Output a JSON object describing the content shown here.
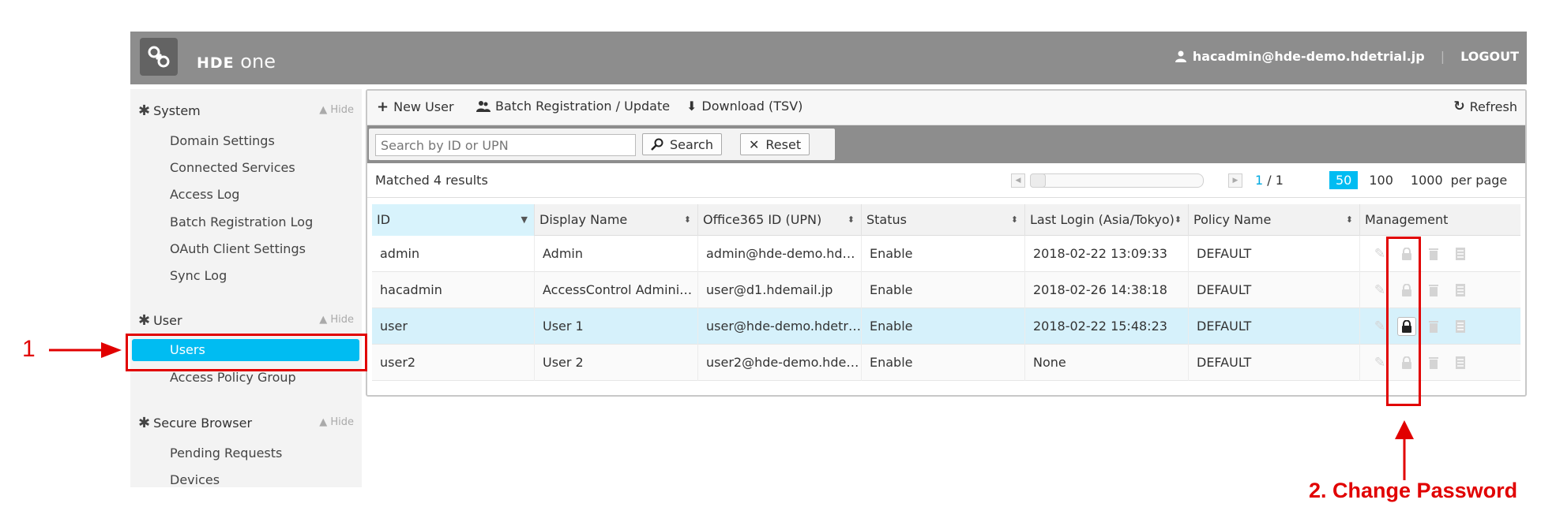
{
  "header": {
    "logo_brand": "HDE",
    "logo_product": "one",
    "user_email": "hacadmin@hde-demo.hdetrial.jp",
    "logout_label": "LOGOUT"
  },
  "sidebar": {
    "sections": [
      {
        "title": "System",
        "hide_label": "▲ Hide",
        "items": [
          "Domain Settings",
          "Connected Services",
          "Access Log",
          "Batch Registration Log",
          "OAuth Client Settings",
          "Sync Log"
        ]
      },
      {
        "title": "User",
        "hide_label": "▲ Hide",
        "items": [
          "Users",
          "Access Policy Group"
        ]
      },
      {
        "title": "Secure Browser",
        "hide_label": "▲ Hide",
        "items": [
          "Pending Requests",
          "Devices"
        ]
      }
    ],
    "active_item": "Users"
  },
  "toolbar": {
    "new_user": "New User",
    "batch": "Batch Registration / Update",
    "download": "Download (TSV)",
    "refresh": "Refresh"
  },
  "search": {
    "placeholder": "Search by ID or UPN",
    "search_label": "Search",
    "reset_label": "Reset"
  },
  "pager": {
    "matched": "Matched 4 results",
    "current_page": "1",
    "page_sep": "/",
    "total_pages": "1",
    "per_page_options": [
      "50",
      "100",
      "1000"
    ],
    "per_page_selected": "50",
    "per_page_label": "per page"
  },
  "table": {
    "headers": [
      "ID",
      "Display Name",
      "Office365 ID (UPN)",
      "Status",
      "Last Login (Asia/Tokyo)",
      "Policy Name",
      "Management"
    ],
    "rows": [
      [
        "admin",
        "Admin",
        "admin@hde-demo.hde···",
        "Enable",
        "2018-02-22 13:09:33",
        "DEFAULT"
      ],
      [
        "hacadmin",
        "AccessControl Adminis···",
        "user@d1.hdemail.jp",
        "Enable",
        "2018-02-26 14:38:18",
        "DEFAULT"
      ],
      [
        "user",
        "User 1",
        "user@hde-demo.hdetri···",
        "Enable",
        "2018-02-22 15:48:23",
        "DEFAULT"
      ],
      [
        "user2",
        "User 2",
        "user2@hde-demo.hdet···",
        "Enable",
        "None",
        "DEFAULT"
      ]
    ],
    "selected_row": 2
  },
  "annotations": {
    "step1": "1",
    "step2_num": "2.",
    "step2_text": "Change Password",
    "color": "#e10000"
  },
  "colors": {
    "accent": "#00bcf2",
    "header_bg": "#8d8d8d"
  }
}
